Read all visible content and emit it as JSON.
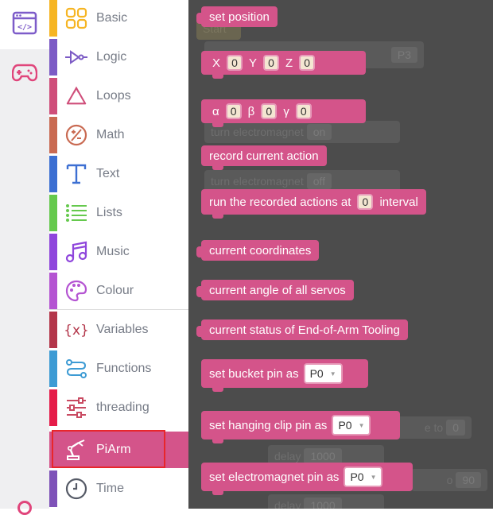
{
  "rail": {
    "tabs": [
      {
        "name": "code-blocks-icon",
        "active": true
      },
      {
        "name": "gamepad-icon",
        "active": false
      }
    ]
  },
  "categories": [
    {
      "label": "Basic",
      "color": "#f6b523",
      "icon": "grid-icon"
    },
    {
      "label": "Logic",
      "color": "#7c5bc5",
      "icon": "logic-gate-icon"
    },
    {
      "label": "Loops",
      "color": "#cf4e7a",
      "icon": "recycle-icon"
    },
    {
      "label": "Math",
      "color": "#c96a52",
      "icon": "plus-minus-icon"
    },
    {
      "label": "Text",
      "color": "#3c6fd2",
      "icon": "text-t-icon"
    },
    {
      "label": "Lists",
      "color": "#65c94d",
      "icon": "list-icon"
    },
    {
      "label": "Music",
      "color": "#8f46dc",
      "icon": "music-note-icon"
    },
    {
      "label": "Colour",
      "color": "#b454d2",
      "icon": "palette-icon"
    },
    {
      "label": "Variables",
      "color": "#b3364a",
      "icon": "braces-x-icon"
    },
    {
      "label": "Functions",
      "color": "#3d9bd4",
      "icon": "functions-icon"
    },
    {
      "label": "threading",
      "color": "#e51c49",
      "icon": "sliders-icon"
    },
    {
      "label": "PiArm",
      "color": "#d4548a",
      "icon": "robot-arm-icon"
    },
    {
      "label": "Time",
      "color": "#7e52b8",
      "icon": "clock-icon"
    }
  ],
  "workspace": {
    "background": "#4c4c4c",
    "ghost_blocks": [
      {
        "text": "Start"
      },
      {
        "text": "P3"
      },
      {
        "text": "turn electromagnet",
        "value": "on"
      },
      {
        "text": "turn electromagnet",
        "value": "off"
      },
      {
        "text": "e to",
        "value": "0"
      },
      {
        "text": "delay",
        "value": "1000"
      },
      {
        "text": "o",
        "value": "90"
      },
      {
        "text": "delay",
        "value": "1000"
      }
    ]
  },
  "flyout": {
    "accent": "#d4548a",
    "set_position": "set position",
    "xyz": {
      "x_label": "X",
      "x": "0",
      "y_label": "Y",
      "y": "0",
      "z_label": "Z",
      "z": "0"
    },
    "angles": {
      "a_label": "α",
      "a": "0",
      "b_label": "β",
      "b": "0",
      "g_label": "γ",
      "g": "0"
    },
    "record": "record current action",
    "run_recorded": {
      "label": "run the recorded actions at",
      "value": "0",
      "suffix": "interval"
    },
    "current_coords": "current coordinates",
    "current_angle": "current angle of all servos",
    "current_status": "current status of End-of-Arm Tooling",
    "bucket_pin": {
      "label": "set bucket pin as",
      "value": "P0"
    },
    "clip_pin": {
      "label": "set hanging clip pin as",
      "value": "P0"
    },
    "magnet_pin": {
      "label": "set electromagnet pin as",
      "value": "P0"
    }
  }
}
